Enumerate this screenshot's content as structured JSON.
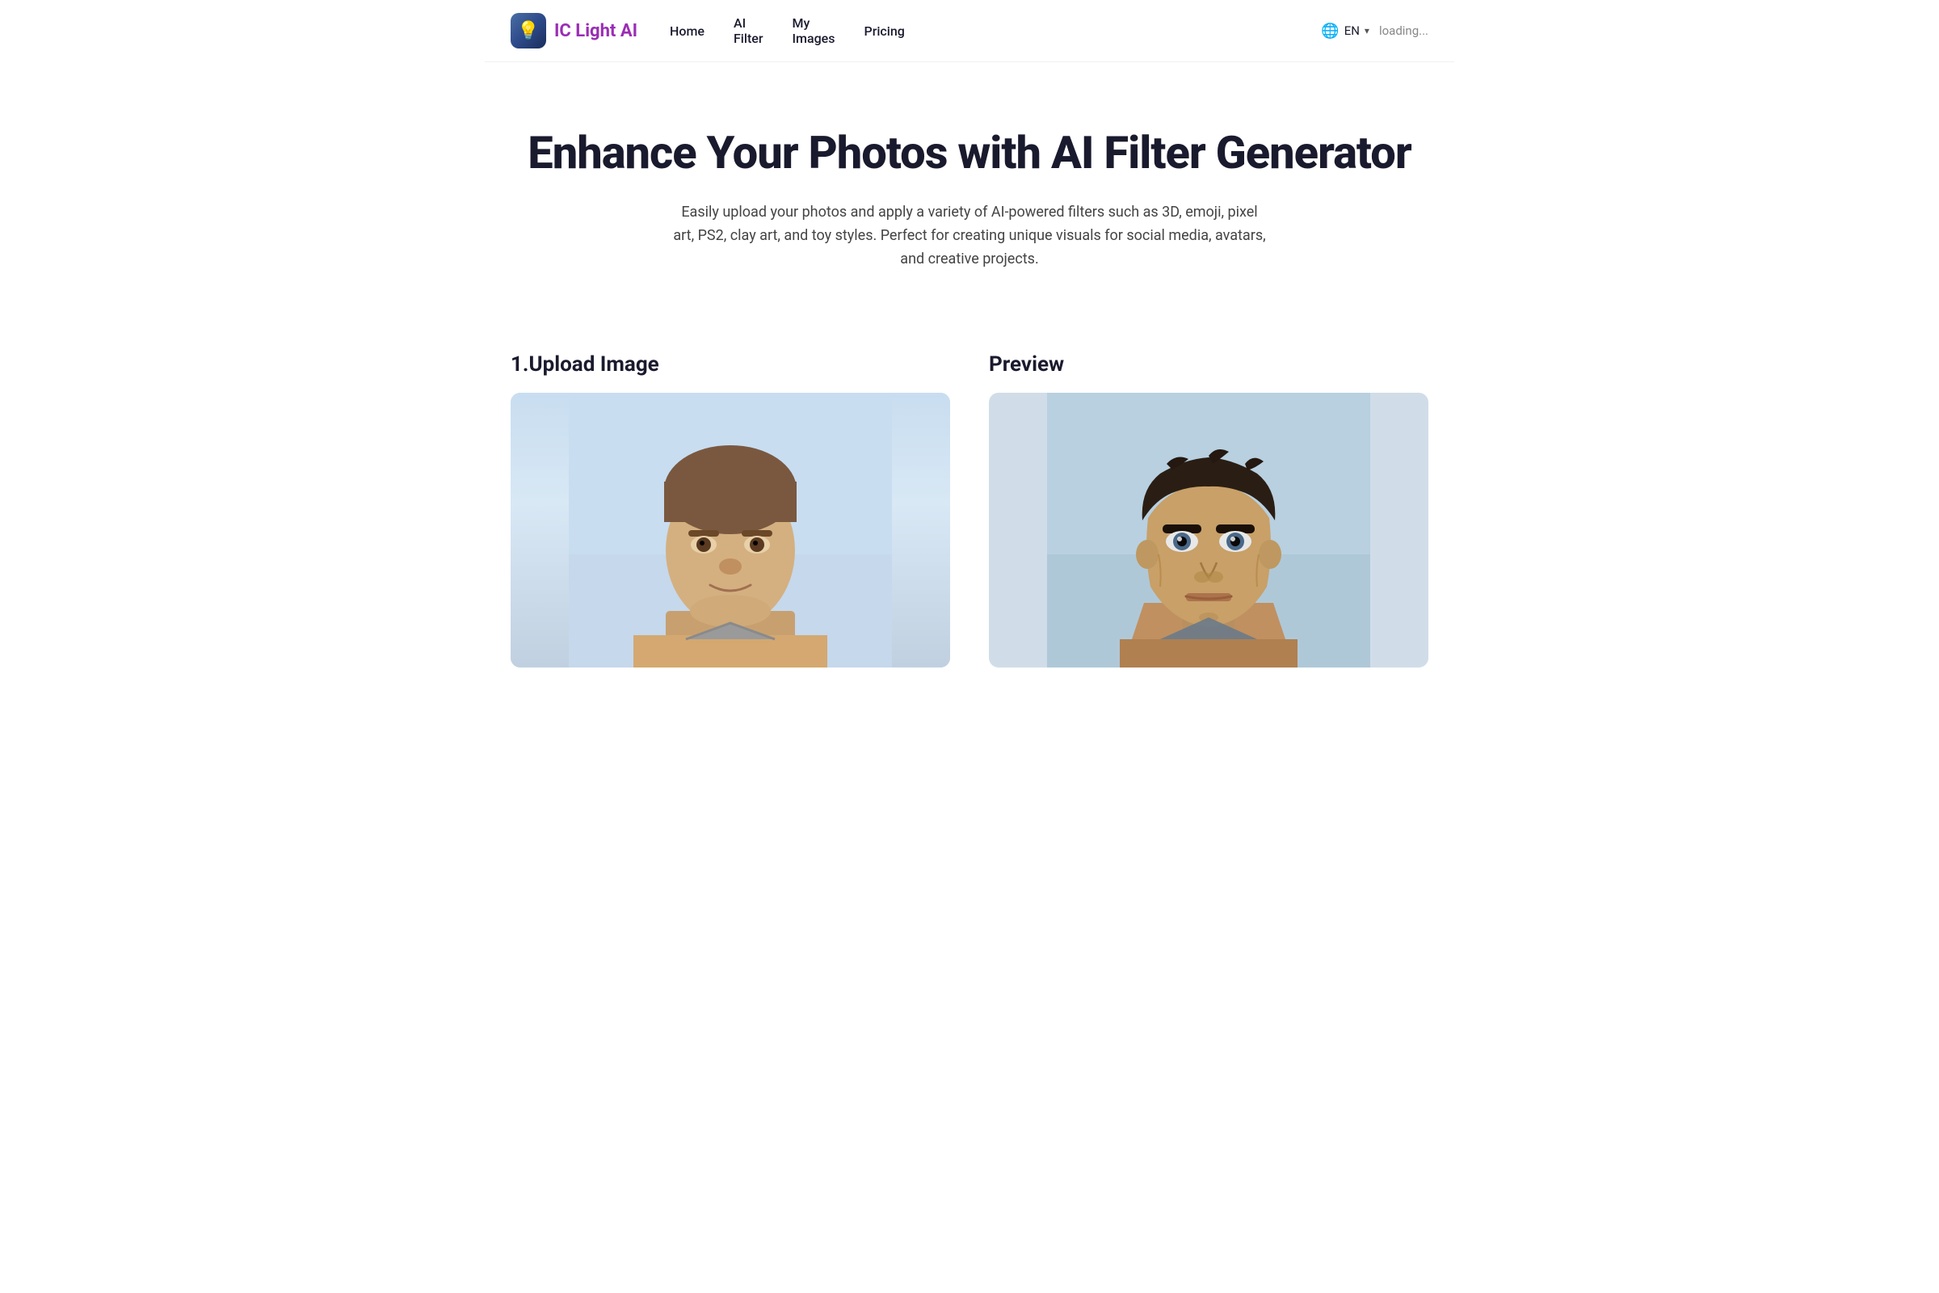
{
  "navbar": {
    "logo": {
      "icon": "💡",
      "text": "IC Light AI"
    },
    "links": [
      {
        "id": "home",
        "label": "Home"
      },
      {
        "id": "ai-filter",
        "label": "AI\nFilter"
      },
      {
        "id": "my-images",
        "label": "My\nImages"
      },
      {
        "id": "pricing",
        "label": "Pricing"
      }
    ],
    "language": {
      "icon": "🌐",
      "code": "EN",
      "chevron": "▾"
    },
    "status": "loading..."
  },
  "hero": {
    "title": "Enhance Your Photos with AI Filter Generator",
    "subtitle": "Easily upload your photos and apply a variety of AI-powered filters such as 3D, emoji, pixel art, PS2, clay art, and toy styles. Perfect for creating unique visuals for social media, avatars, and creative projects."
  },
  "main": {
    "upload_section": {
      "title": "1.Upload Image"
    },
    "preview_section": {
      "title": "Preview"
    }
  },
  "colors": {
    "brand_purple": "#9b2db5",
    "nav_text": "#1a1a2e",
    "hero_title": "#1a1a2e",
    "body_text": "#444444"
  }
}
